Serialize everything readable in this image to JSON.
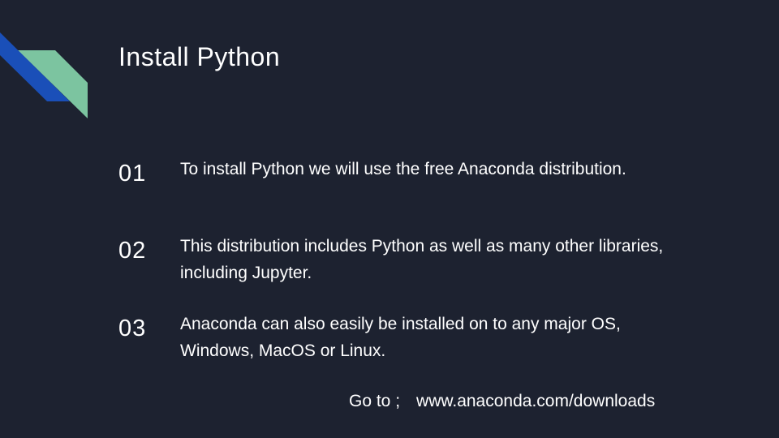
{
  "slide": {
    "title": "Install Python",
    "items": [
      {
        "number": "01",
        "text": "To install Python we will use the free Anaconda distribution."
      },
      {
        "number": "02",
        "text": "This distribution includes Python as well as many other libraries, including Jupyter."
      },
      {
        "number": "03",
        "text": "Anaconda can also easily be installed on to any major OS, Windows, MacOS or Linux."
      }
    ],
    "footer": {
      "label": "Go to ;",
      "url": "www.anaconda.com/downloads"
    }
  },
  "colors": {
    "background": "#1d2230",
    "accent_blue": "#1a4fb8",
    "accent_green": "#7cc4a0",
    "text": "#ffffff"
  }
}
